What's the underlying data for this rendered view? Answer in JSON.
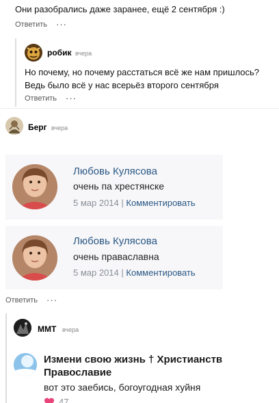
{
  "comment_top": {
    "text": "Они разобрались даже заранее, ещё 2 сентября :)",
    "reply_label": "Ответить",
    "more_label": "···"
  },
  "comment_robik": {
    "author": "робик",
    "time": "вчера",
    "text_line1": "Но почему, но почему расстаться всё же нам пришлось?",
    "text_line2": "Ведь было всё у нас всерьёз второго сентября",
    "reply_label": "Ответить",
    "more_label": "···"
  },
  "comment_berg": {
    "author": "Берг",
    "time": "вчера",
    "reply_label": "Ответить",
    "more_label": "···",
    "screenshot_posts": [
      {
        "name": "Любовь Кулясова",
        "text": "очень па хрестянске",
        "date": "5 мар 2014",
        "separator": "|",
        "action": "Комментировать"
      },
      {
        "name": "Любовь Кулясова",
        "text": "очень праваславна",
        "date": "5 мар 2014",
        "separator": "|",
        "action": "Комментировать"
      }
    ]
  },
  "comment_mmt": {
    "author": "ММТ",
    "time": "вчера",
    "screenshot_post": {
      "title_line1": "Измени свою жизнь † Христианств",
      "title_line2": "Православие",
      "text": "вот это заебись, богоугодная хуйня",
      "likes": "47"
    }
  },
  "colors": {
    "link_blue": "#2a5885",
    "meta_grey": "#8a8f96",
    "like_pink": "#e8447a"
  }
}
